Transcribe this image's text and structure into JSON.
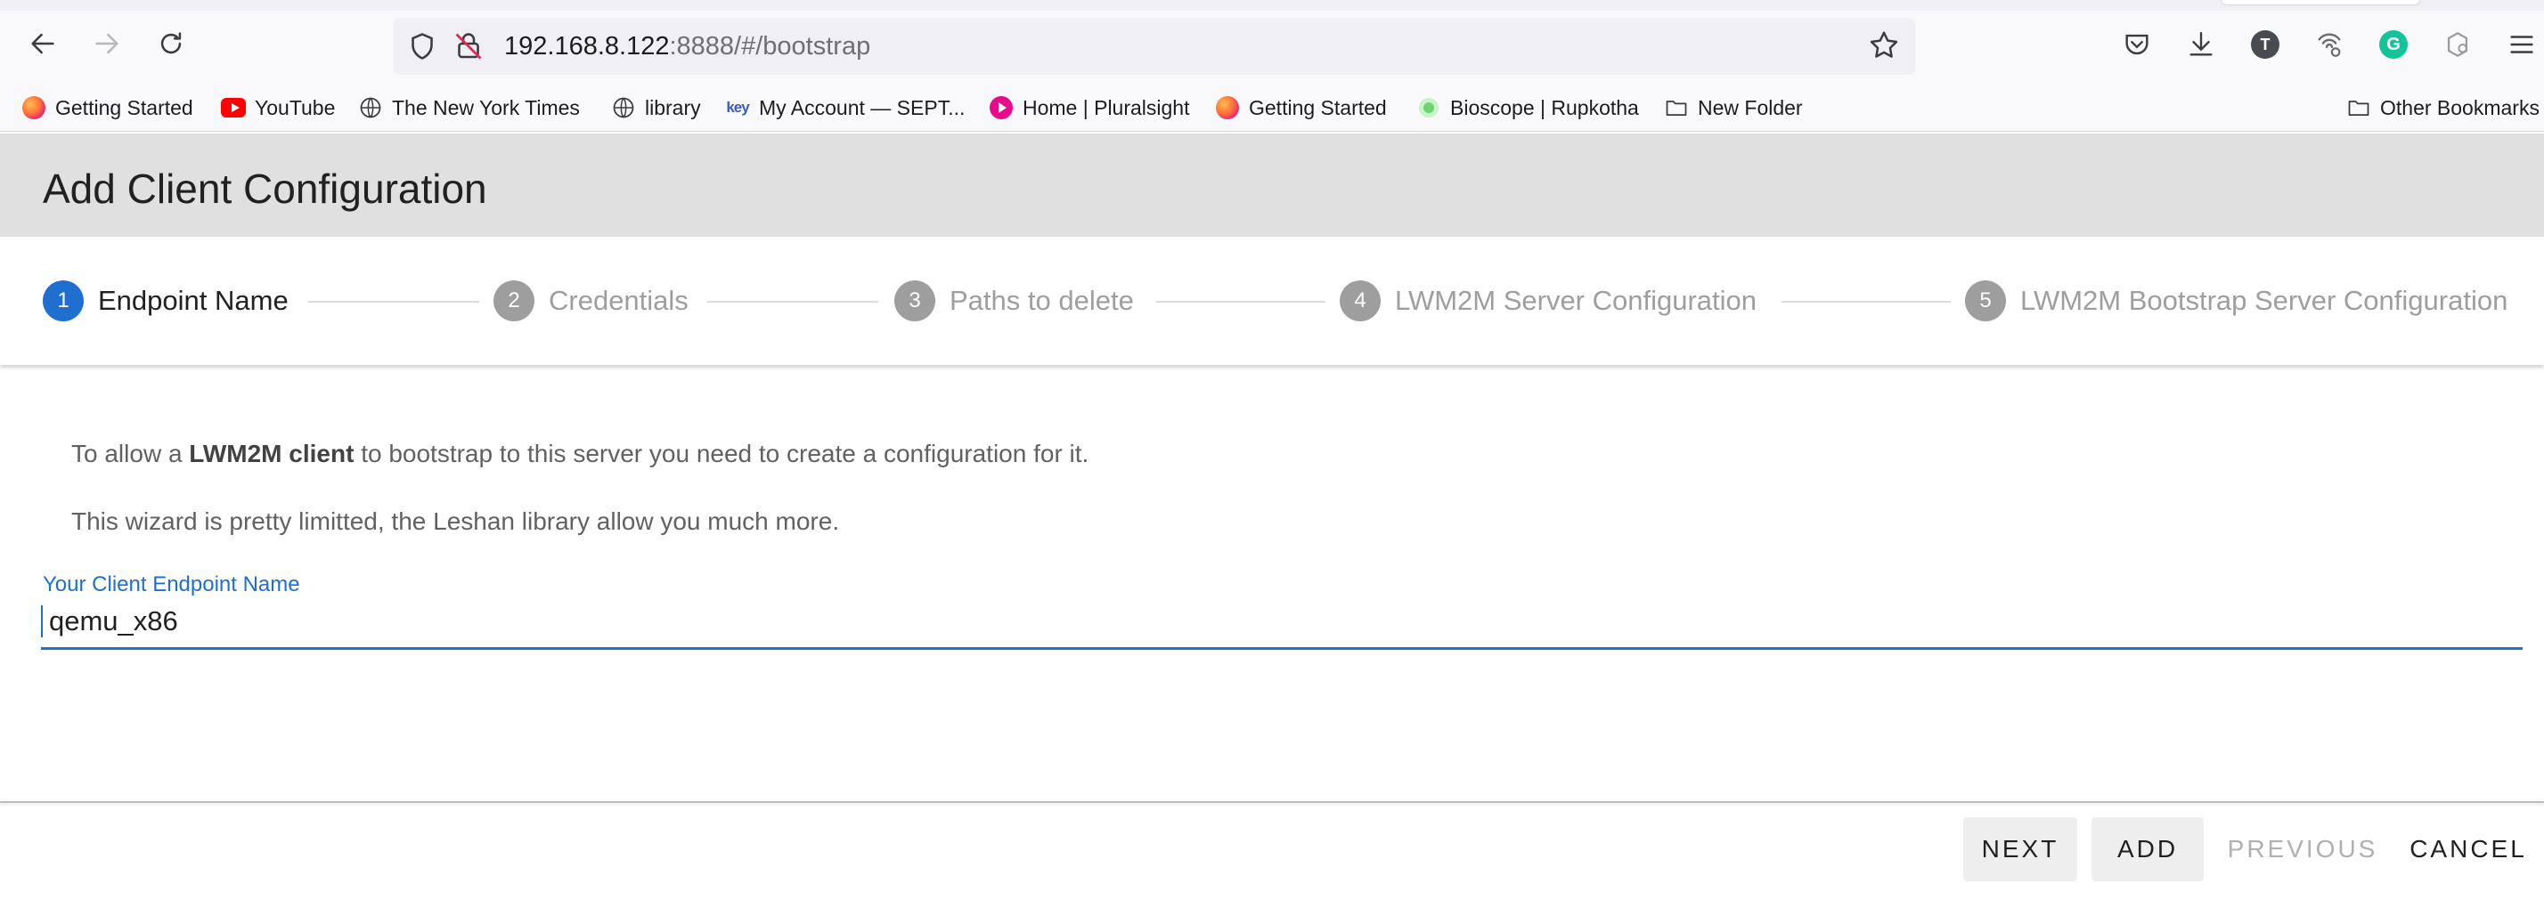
{
  "browser": {
    "url_host": "192.168.8.122",
    "url_rest": ":8888/#/bootstrap",
    "bookmarks": [
      {
        "label": "Getting Started",
        "icon": "firefox-icon"
      },
      {
        "label": "YouTube",
        "icon": "youtube-icon"
      },
      {
        "label": "The New York Times",
        "icon": "globe-icon"
      },
      {
        "label": "library",
        "icon": "globe-icon"
      },
      {
        "label": "My Account — SEPT...",
        "icon": "key-icon"
      },
      {
        "label": "Home | Pluralsight",
        "icon": "pluralsight-icon"
      },
      {
        "label": "Getting Started",
        "icon": "firefox-icon"
      },
      {
        "label": "Bioscope | Rupkotha",
        "icon": "bioscope-icon"
      },
      {
        "label": "New Folder",
        "icon": "folder-icon"
      }
    ],
    "other_bookmarks": "Other Bookmarks",
    "avatar_t": "T",
    "avatar_g": "G",
    "key_glyph": "key"
  },
  "app": {
    "title": "Add Client Configuration",
    "steps": [
      {
        "num": "1",
        "label": "Endpoint Name",
        "active": true
      },
      {
        "num": "2",
        "label": "Credentials",
        "active": false
      },
      {
        "num": "3",
        "label": "Paths to delete",
        "active": false
      },
      {
        "num": "4",
        "label": "LWM2M Server Configuration",
        "active": false
      },
      {
        "num": "5",
        "label": "LWM2M Bootstrap Server Configuration",
        "active": false
      }
    ],
    "intro_prefix": "To allow a ",
    "intro_bold": "LWM2M client",
    "intro_suffix": " to bootstrap to this server you need to create a configuration for it.",
    "wizard_note": "This wizard is pretty limitted, the Leshan library allow you much more.",
    "field_label": "Your Client Endpoint Name",
    "field_value": "qemu_x86",
    "buttons": {
      "next": "NEXT",
      "add": "ADD",
      "previous": "PREVIOUS",
      "cancel": "CANCEL"
    }
  },
  "colors": {
    "accent": "#1e6fd0",
    "header_bg": "#e0e0e0",
    "step_inactive": "#9e9e9e"
  }
}
